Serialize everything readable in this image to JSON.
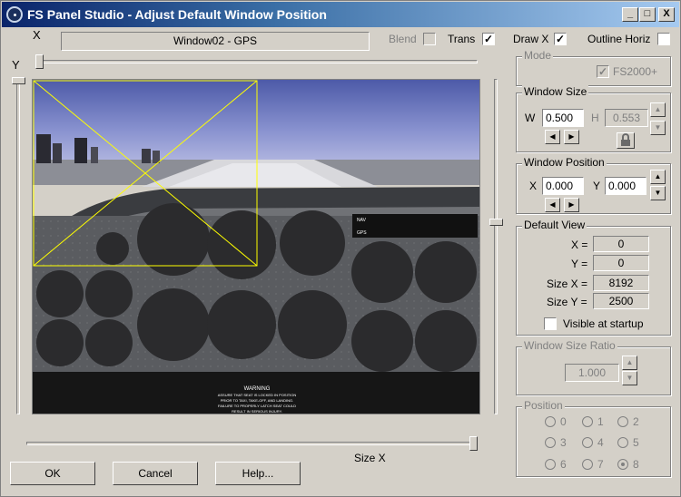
{
  "title": "FS Panel Studio - Adjust Default Window Position",
  "title_buttons": [
    "_",
    "□",
    "X"
  ],
  "top": {
    "x_axis_label": "X",
    "y_axis_label": "Y",
    "window_name": "Window02 - GPS",
    "blend_label": "Blend",
    "blend_checked": false,
    "trans_label": "Trans",
    "trans_checked": true,
    "draw_label": "Draw X",
    "draw_checked": true,
    "outline_label": "Outline Horiz",
    "outline_checked": false,
    "check_mark": "✓"
  },
  "mode": {
    "title": "Mode",
    "fs2000_label": "FS2000+",
    "fs2000_checked": true
  },
  "window_size": {
    "title": "Window Size",
    "w_label": "W",
    "w_value": "0.500",
    "h_label": "H",
    "h_value": "0.553",
    "left_arrow": "◀",
    "right_arrow": "▶",
    "up_arrow": "▲",
    "down_arrow": "▼"
  },
  "window_position": {
    "title": "Window Position",
    "x_label": "X",
    "x_value": "0.000",
    "y_label": "Y",
    "y_value": "0.000"
  },
  "default_view": {
    "title": "Default View",
    "rows": [
      {
        "label": "X =",
        "value": "0"
      },
      {
        "label": "Y =",
        "value": "0"
      },
      {
        "label": "Size X =",
        "value": "8192"
      },
      {
        "label": "Size Y =",
        "value": "2500"
      }
    ],
    "visible_label": "Visible at startup",
    "visible_checked": false
  },
  "ratio": {
    "title": "Window Size Ratio",
    "value": "1.000"
  },
  "position": {
    "title": "Position",
    "options": [
      "0",
      "1",
      "2",
      "3",
      "4",
      "5",
      "6",
      "7",
      "8"
    ],
    "selected": "8"
  },
  "bottom": {
    "size_x_label": "Size X",
    "ok_label": "OK",
    "cancel_label": "Cancel",
    "help_label": "Help..."
  },
  "panel_texts": {
    "nav": "NAV",
    "gps": "GPS",
    "warning_title": "WARNING",
    "warning_lines": [
      "ASSURE THAT SEAT IS LOCKED IN POSITION",
      "PRIOR TO TAXI, TAKE-OFF, AND LANDING.",
      "FAILURE TO PROPERLY LATCH SEAT COULD",
      "RESULT IN SERIOUS INJURY."
    ]
  },
  "colors": {
    "window_bg": "#d4d0c8",
    "title_start": "#0a246a",
    "title_end": "#a6caf0",
    "overlay": "#ffff00",
    "panel": "#5a5c60"
  }
}
